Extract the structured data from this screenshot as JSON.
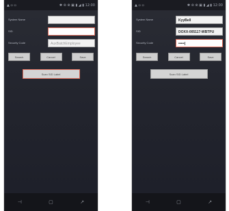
{
  "status_bar": {
    "left": "▲ ▫ ▫",
    "right": "✱ ⊜ ⊗ ▣ ▮ ◢ ▮ 12:00"
  },
  "left_screen": {
    "labels": {
      "system_name": "System Name",
      "sid": "SID",
      "security_code": "Security Code"
    },
    "fields": {
      "system_name": "",
      "sid": "",
      "security_code_placeholder": "AuxBatchEmployee"
    },
    "buttons": {
      "search": "Search",
      "cancel": "Cancel",
      "save": "Save"
    },
    "scan_button": "Scan SID Label"
  },
  "right_screen": {
    "labels": {
      "system_name": "System Name",
      "sid": "SID",
      "security_code": "Security Code"
    },
    "fields": {
      "system_name": "KyyBell",
      "sid": "DOXX-005117-WBTPU",
      "security_code": "•••••|"
    },
    "buttons": {
      "search": "Search",
      "cancel": "Cancel",
      "save": "Save"
    },
    "scan_button": "Scan SID Label"
  },
  "nav_bar": {
    "back": "⊣",
    "home": "▢",
    "recents": "↗"
  }
}
